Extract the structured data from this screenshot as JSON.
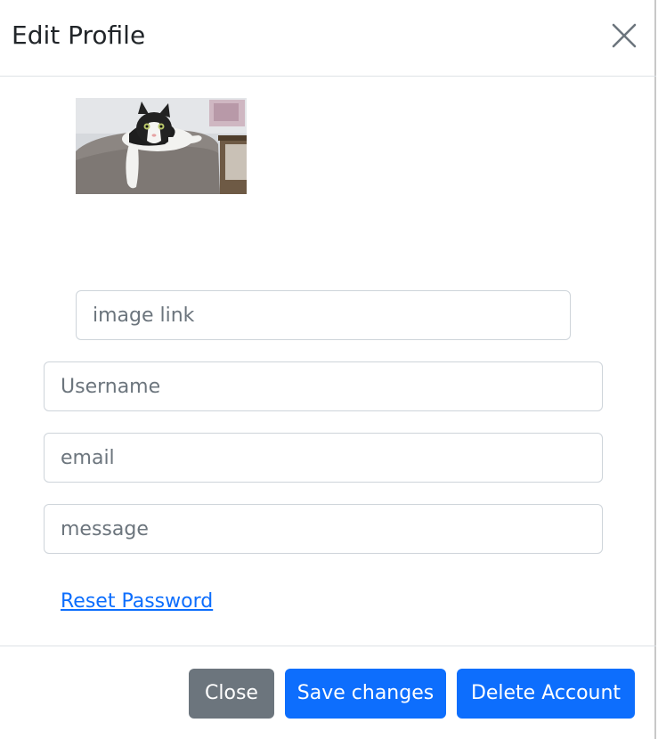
{
  "modal": {
    "title": "Edit Profile",
    "close_icon": "close-icon"
  },
  "profile_image": {
    "icon": "cat-photo"
  },
  "form": {
    "image_link_placeholder": "image link",
    "username_placeholder": "Username",
    "email_placeholder": "email",
    "message_placeholder": "message",
    "reset_password_label": "Reset Password"
  },
  "footer": {
    "close_label": "Close",
    "save_label": "Save changes",
    "delete_label": "Delete Account"
  },
  "colors": {
    "primary": "#0d6efd",
    "secondary": "#6c757d",
    "border": "#ced4da"
  }
}
